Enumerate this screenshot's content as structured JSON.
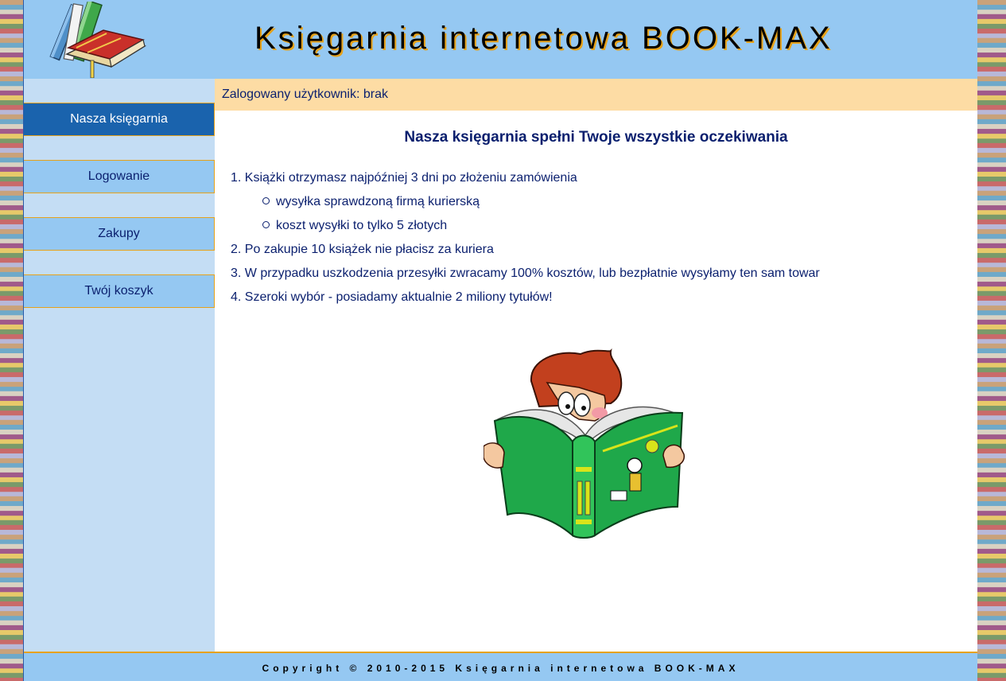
{
  "header": {
    "title": "Księgarnia internetowa BOOK-MAX"
  },
  "sidebar": {
    "items": [
      {
        "label": "Nasza księgarnia",
        "active": true
      },
      {
        "label": "Logowanie",
        "active": false
      },
      {
        "label": "Zakupy",
        "active": false
      },
      {
        "label": "Twój koszyk",
        "active": false
      }
    ]
  },
  "userbar": {
    "text": "Zalogowany użytkownik: brak"
  },
  "main": {
    "heading": "Nasza księgarnia spełni Twoje wszystkie oczekiwania",
    "items": [
      {
        "num": "1.",
        "text": "Książki otrzymasz najpóźniej 3 dni po złożeniu zamówienia",
        "sub": [
          "wysyłka sprawdzoną firmą kurierską",
          "koszt wysyłki to tylko 5 złotych"
        ]
      },
      {
        "num": "2.",
        "text": "Po zakupie 10 książek nie płacisz za kuriera"
      },
      {
        "num": "3.",
        "text": "W przypadku uszkodzenia przesyłki zwracamy 100% kosztów, lub bezpłatnie wysyłamy ten sam towar"
      },
      {
        "num": "4.",
        "text": "Szeroki wybór - posiadamy aktualnie 2 miliony tytułów!"
      }
    ]
  },
  "footer": {
    "text": "Copyright © 2010-2015 Księgarnia internetowa BOOK-MAX"
  },
  "colors": {
    "header_bg": "#95c8f2",
    "sidebar_bg": "#c4ddf4",
    "active_nav": "#1a63ad",
    "userbar_bg": "#fddca4",
    "accent_border": "#e6a21a",
    "text": "#0a1f6e"
  }
}
